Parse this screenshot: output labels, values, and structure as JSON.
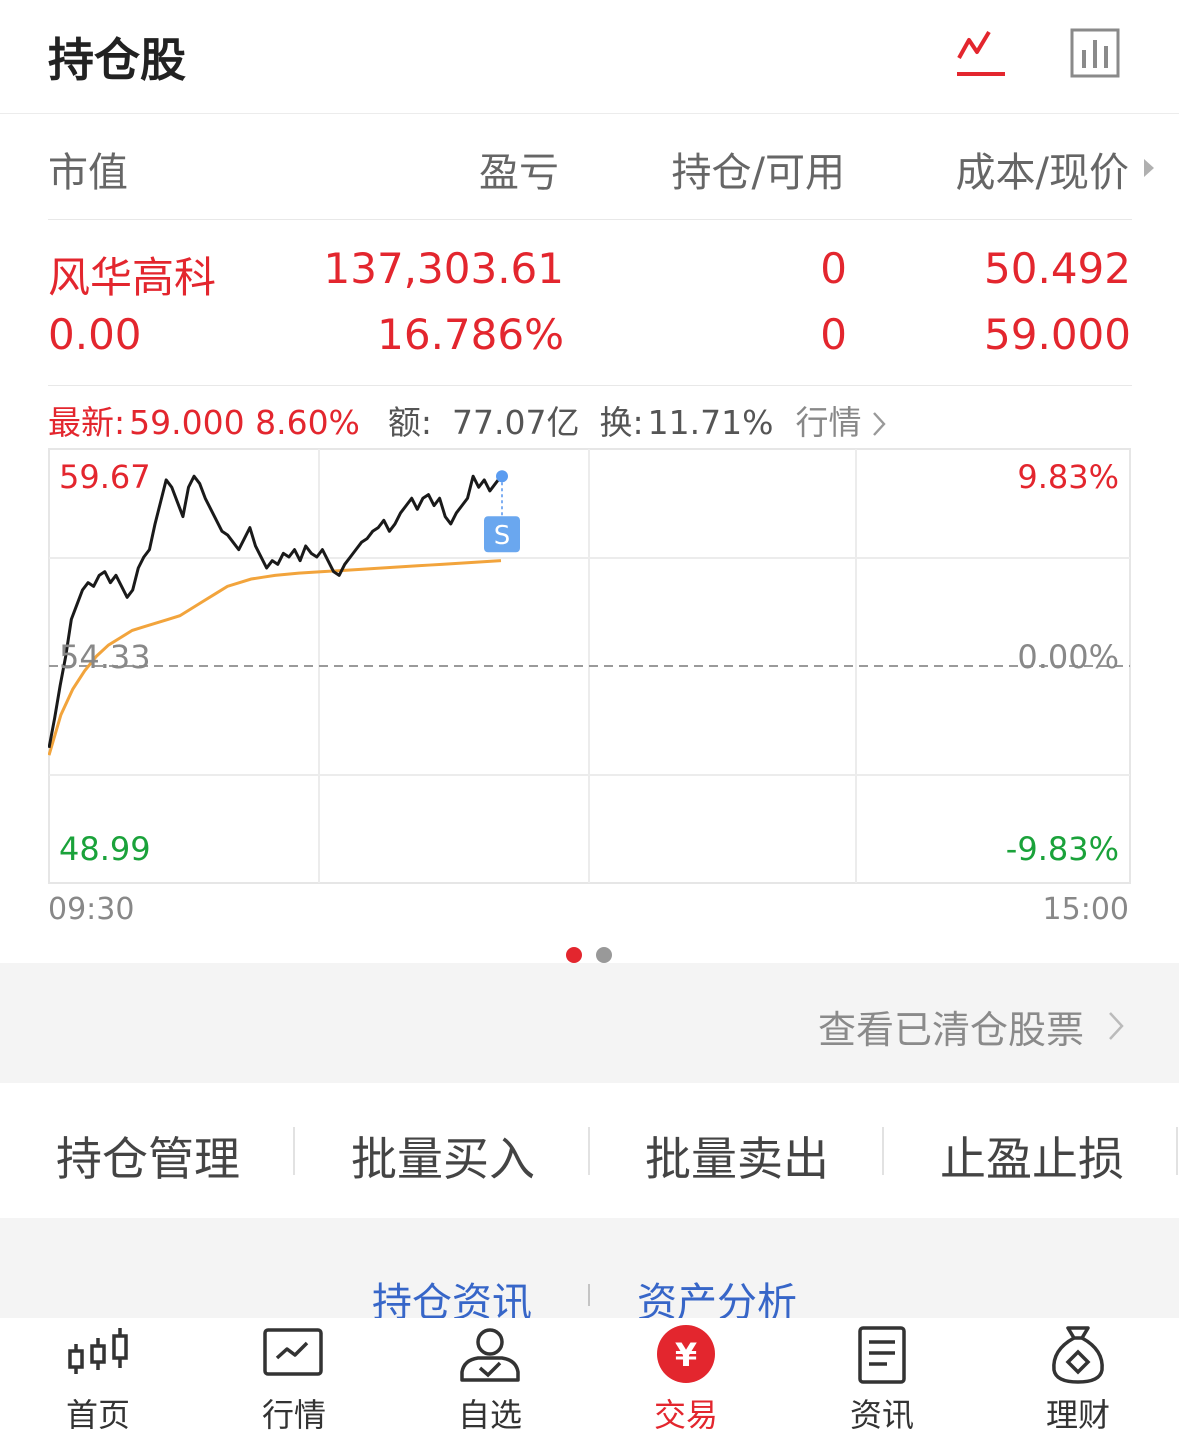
{
  "header": {
    "title": "持仓股",
    "icons": [
      "line-chart-icon",
      "bar-chart-icon"
    ],
    "active_color": "#e3262e"
  },
  "table": {
    "columns": [
      "市值",
      "盈亏",
      "持仓/可用",
      "成本/现价"
    ],
    "rows": [
      {
        "name": "风华高科",
        "market_value": "0.00",
        "profit_loss": "137,303.61",
        "profit_loss_ratio": "16.786%",
        "holding": "0",
        "available": "0",
        "cost": "50.492",
        "price": "59.000"
      }
    ]
  },
  "quote": {
    "latest_label": "最新:",
    "latest_value": "59.000 8.60%",
    "amount_label": "额:",
    "amount_value": "77.07亿",
    "turnover_label": "换:",
    "turnover_value": "11.71%",
    "more_label": "行情"
  },
  "chart_data": {
    "type": "line",
    "y_left_ticks": [
      "59.67",
      "54.33",
      "48.99"
    ],
    "y_right_ticks": [
      "9.83%",
      "0.00%",
      "-9.83%"
    ],
    "x_ticks": [
      "09:30",
      "15:00"
    ],
    "ylim": [
      48.99,
      59.67
    ],
    "prev_close": 54.33,
    "marker_label": "S",
    "series": [
      {
        "values": [
          52.1,
          52.9,
          53.8,
          54.6,
          55.6,
          56.0,
          56.4,
          56.6,
          56.5,
          56.8,
          56.9,
          56.6,
          56.8,
          56.5,
          56.2,
          56.4,
          57.0,
          57.3,
          57.5,
          58.2,
          58.8,
          59.4,
          59.2,
          58.8,
          58.4,
          59.2,
          59.5,
          59.3,
          58.9,
          58.6,
          58.3,
          58.0,
          57.9,
          57.7,
          57.5,
          57.8,
          58.1,
          57.6,
          57.3,
          57.0,
          57.2,
          57.1,
          57.4,
          57.3,
          57.5,
          57.2,
          57.6,
          57.4,
          57.3,
          57.5,
          57.2,
          56.9,
          56.8,
          57.1,
          57.3,
          57.5,
          57.7,
          57.8,
          58.0,
          58.1,
          58.3,
          58.0,
          58.2,
          58.5,
          58.7,
          58.9,
          58.6,
          58.9,
          59.0,
          58.7,
          58.9,
          58.4,
          58.2,
          58.5,
          58.7,
          58.9,
          59.5,
          59.2,
          59.4,
          59.1,
          59.3,
          59.5
        ]
      },
      {
        "values": [
          51.9,
          53.0,
          53.7,
          54.2,
          54.6,
          54.9,
          55.1,
          55.3,
          55.4,
          55.5,
          55.6,
          55.7,
          55.9,
          56.1,
          56.3,
          56.5,
          56.6,
          56.7,
          56.75,
          56.8,
          56.83,
          56.86,
          56.88,
          56.9,
          56.92,
          56.94,
          56.96,
          56.98,
          57.0,
          57.02,
          57.04,
          57.06,
          57.08,
          57.1,
          57.12,
          57.14,
          57.16,
          57.18,
          57.2
        ]
      }
    ],
    "colors": {
      "price": "#1a1a1a",
      "avg": "#f2a43c",
      "up": "#e3262e",
      "down": "#1aa23a"
    }
  },
  "pager": {
    "count": 2,
    "active": 1
  },
  "cleared_link": "查看已清仓股票",
  "actions": [
    "持仓管理",
    "批量买入",
    "批量卖出",
    "止盈止损"
  ],
  "info_links": [
    "持仓资讯",
    "资产分析"
  ],
  "tabs": [
    {
      "label": "首页",
      "icon": "candlestick-icon"
    },
    {
      "label": "行情",
      "icon": "market-chart-icon"
    },
    {
      "label": "自选",
      "icon": "user-check-icon"
    },
    {
      "label": "交易",
      "icon": "yuan-icon",
      "active": true
    },
    {
      "label": "资讯",
      "icon": "document-icon"
    },
    {
      "label": "理财",
      "icon": "money-bag-icon"
    }
  ]
}
